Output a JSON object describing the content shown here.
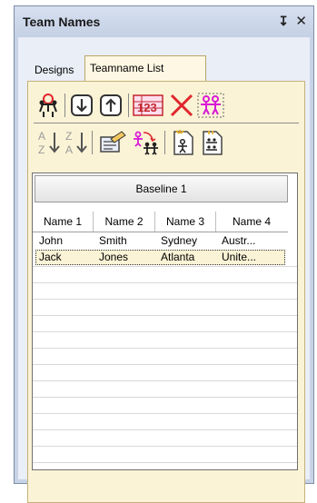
{
  "window": {
    "title": "Team Names",
    "pin_glyph": "↧",
    "close_glyph": "✕"
  },
  "tabs": [
    {
      "label": "Designs"
    },
    {
      "label": "Teamname List"
    }
  ],
  "toolbar": {
    "row1": [
      {
        "icon": "add-person-icon"
      },
      {
        "icon": "move-down-icon"
      },
      {
        "icon": "move-up-icon"
      },
      {
        "icon": "renumber-icon",
        "text": "123"
      },
      {
        "icon": "delete-icon"
      },
      {
        "icon": "select-all-people-icon"
      }
    ],
    "row2": [
      {
        "icon": "sort-ascending-icon",
        "text_top": "A",
        "text_bottom": "Z"
      },
      {
        "icon": "sort-descending-icon",
        "text_top": "Z",
        "text_bottom": "A"
      },
      {
        "icon": "edit-sheet-icon"
      },
      {
        "icon": "swap-people-icon"
      },
      {
        "icon": "import-icon"
      },
      {
        "icon": "export-icon"
      }
    ]
  },
  "grid": {
    "baseline_label": "Baseline 1",
    "columns": [
      "Name 1",
      "Name 2",
      "Name 3",
      "Name 4"
    ],
    "rows": [
      [
        "John",
        "Smith",
        "Sydney",
        "Austr..."
      ],
      [
        "Jack",
        "Jones",
        "Atlanta",
        "Unite..."
      ]
    ],
    "selected_row": 1
  },
  "colors": {
    "accent_red": "#e0262d",
    "accent_magenta": "#d81ad6",
    "selection": "#fbf3d6"
  }
}
